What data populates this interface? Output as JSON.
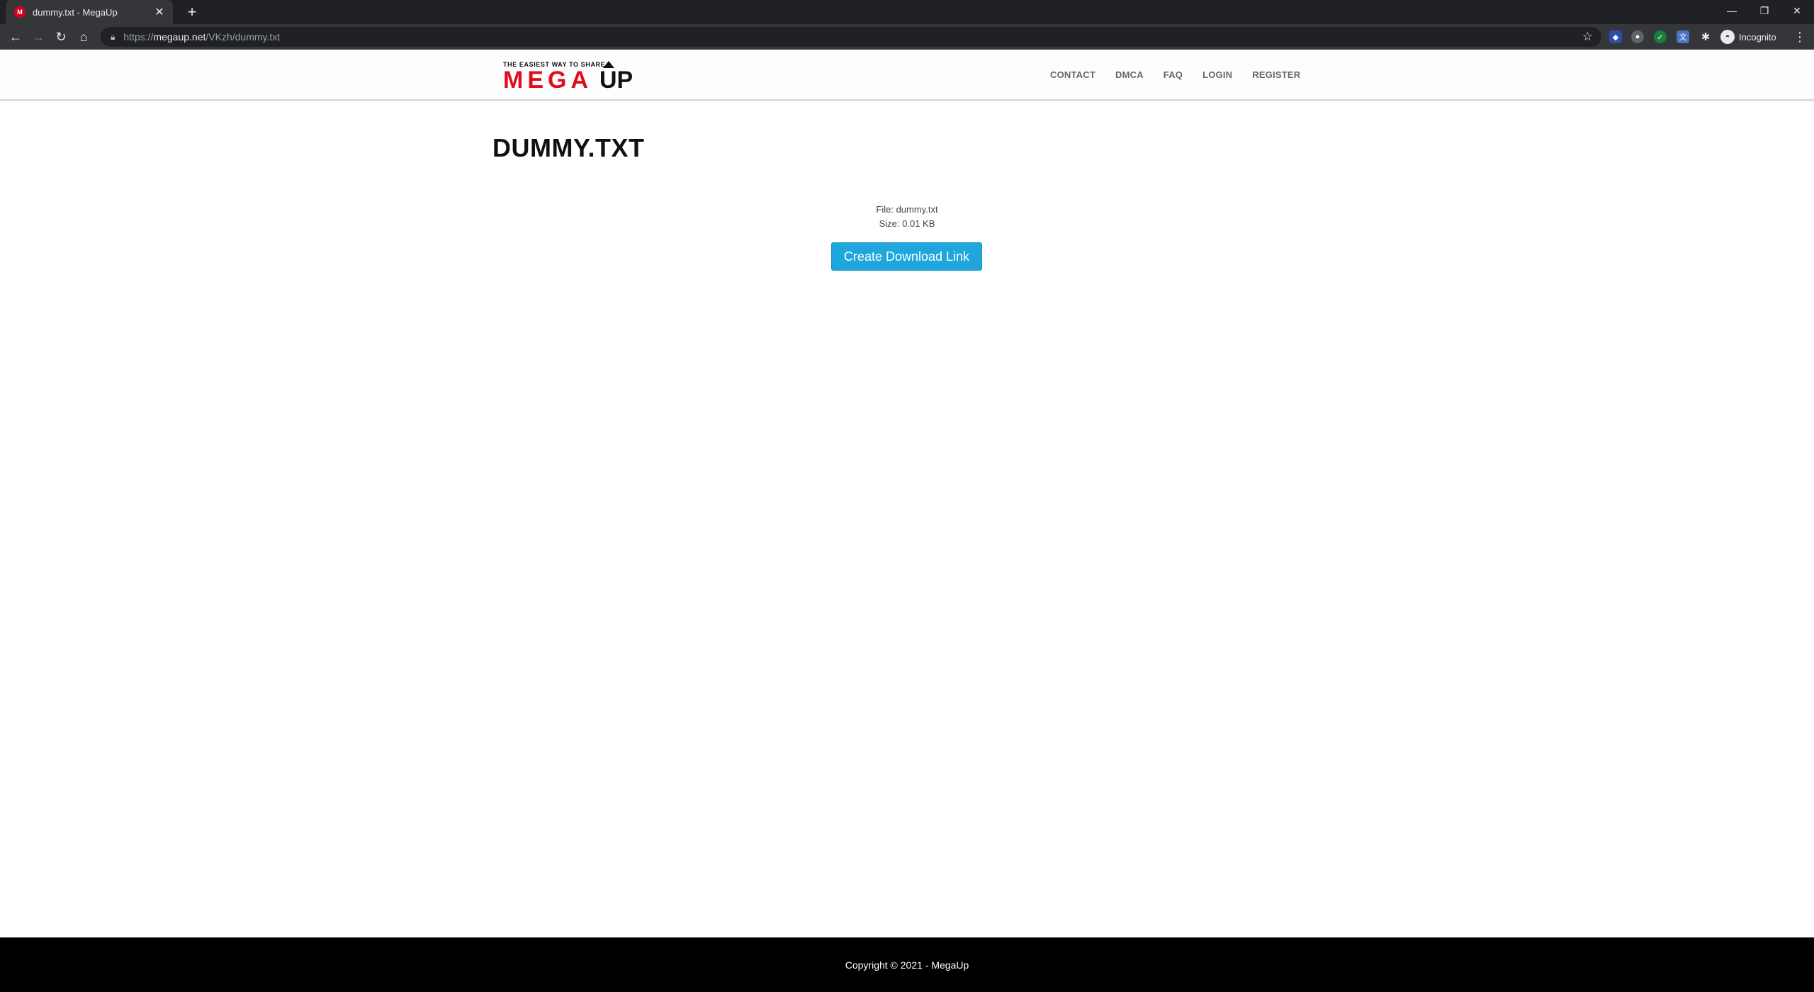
{
  "browser": {
    "tab_title": "dummy.txt - MegaUp",
    "tab_favicon": "M",
    "new_tab_icon": "+",
    "url_scheme": "https://",
    "url_host": "megaup.net",
    "url_path": "/VKzh/dummy.txt",
    "incognito_label": "Incognito",
    "window_controls": [
      "minimize",
      "restore",
      "close"
    ]
  },
  "site": {
    "logo_tagline": "THE EASIEST WAY TO SHARE",
    "logo_mega": "MEGA",
    "logo_up": "UP",
    "nav": [
      "CONTACT",
      "DMCA",
      "FAQ",
      "LOGIN",
      "REGISTER"
    ]
  },
  "main": {
    "title": "DUMMY.TXT",
    "file_line": "File: dummy.txt",
    "size_line": "Size: 0.01 KB",
    "download_button": "Create Download Link"
  },
  "footer": {
    "copyright": "Copyright © 2021 - MegaUp"
  },
  "colors": {
    "brand_red": "#e10d1a",
    "button_blue": "#1fa6dc",
    "footer_bg": "#000000"
  }
}
